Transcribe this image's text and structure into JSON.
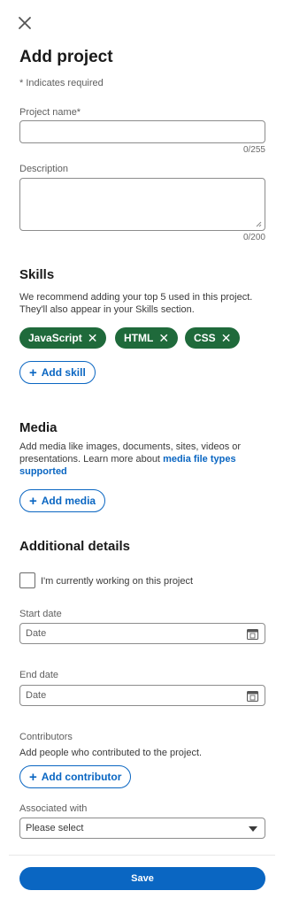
{
  "header": {
    "close_icon": "close-icon",
    "title": "Add project",
    "required_note": "* Indicates required"
  },
  "project_name": {
    "label": "Project name*",
    "value": "",
    "counter": "0/255"
  },
  "description": {
    "label": "Description",
    "value": "",
    "counter": "0/200"
  },
  "skills": {
    "heading": "Skills",
    "description": "We recommend adding your top 5 used in this project. They'll also appear in your Skills section.",
    "chips": [
      {
        "label": "JavaScript",
        "remove_icon": "✕"
      },
      {
        "label": "HTML",
        "remove_icon": "✕"
      },
      {
        "label": "CSS",
        "remove_icon": "✕"
      }
    ],
    "add_button": "Add skill",
    "chip_color": "#1f6a3b"
  },
  "media": {
    "heading": "Media",
    "description": "Add media like images, documents, sites, videos or presentations. Learn more about",
    "link_text": "media file types supported",
    "add_button": "Add media"
  },
  "additional": {
    "heading": "Additional details",
    "checkbox_label": "I'm currently working on this project",
    "checkbox_checked": false,
    "start_date": {
      "label": "Start date",
      "placeholder": "Date"
    },
    "end_date": {
      "label": "End date",
      "placeholder": "Date"
    },
    "contributors": {
      "label": "Contributors",
      "description": "Add people who contributed to the project.",
      "add_button": "Add contributor"
    },
    "associated": {
      "label": "Associated with",
      "selected": "Please select"
    }
  },
  "footer": {
    "save_label": "Save",
    "accent_color": "#0a66c2"
  }
}
